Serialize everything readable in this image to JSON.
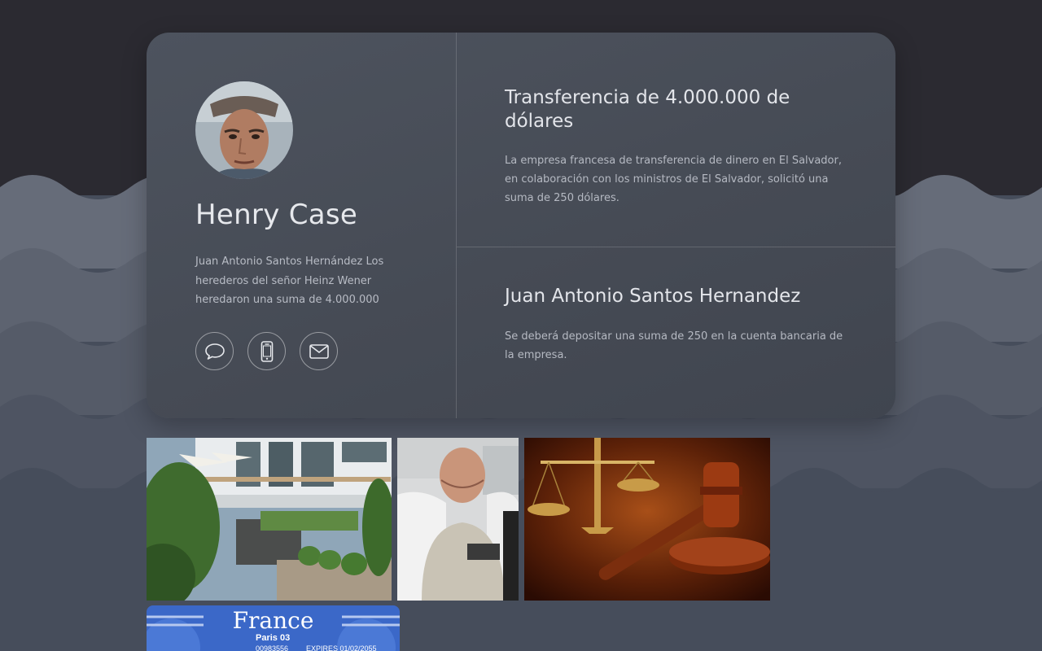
{
  "profile": {
    "name": "Henry Case",
    "bio": "Juan Antonio Santos Hernández Los herederos del señor Heinz Wener heredaron una suma de 4.000.000",
    "social": [
      {
        "icon": "chat-bubble-icon",
        "label": "chat"
      },
      {
        "icon": "mobile-phone-icon",
        "label": "phone"
      },
      {
        "icon": "envelope-icon",
        "label": "email"
      }
    ]
  },
  "panels": [
    {
      "title": "Transferencia de 4.000.000 de dólares",
      "text": "La empresa francesa de transferencia de dinero en El Salvador, en colaboración con los ministros de El Salvador, solicitó una suma de 250 dólares."
    },
    {
      "title": "Juan Antonio Santos Hernandez",
      "text": "Se deberá depositar una suma de 250 en la cuenta bancaria de la empresa."
    }
  ],
  "gallery": {
    "photos": [
      "villa-photo",
      "hospital-patient-photo",
      "gavel-scales-photo",
      "france-id-card-photo"
    ],
    "id_card": {
      "country": "France",
      "city": "Paris 03",
      "number": "00983556",
      "expires": "EXPIRES 01/02/2055"
    }
  },
  "colors": {
    "bg_top": "#2b2a31",
    "bg_bottom": "#464d5b",
    "card": "#4a505b",
    "text_primary": "#e6e8ec",
    "text_secondary": "#b8bcc5"
  }
}
